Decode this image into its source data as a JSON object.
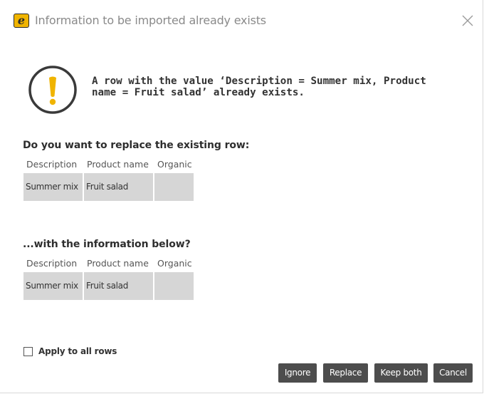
{
  "window": {
    "title": "Information to be imported already exists",
    "logo_letter": "e",
    "close_glyph": "close-icon"
  },
  "message": {
    "line1": "A row with the value ‘Description = Summer mix, Product",
    "line2": "name = Fruit salad’ already exists."
  },
  "existing": {
    "heading": "Do you want to replace the existing row:",
    "columns": [
      "Description",
      "Product name",
      "Organic"
    ],
    "row": [
      "Summer mix",
      "Fruit salad",
      ""
    ]
  },
  "incoming": {
    "heading": "...with the information below?",
    "columns": [
      "Description",
      "Product name",
      "Organic"
    ],
    "row": [
      "Summer mix",
      "Fruit salad",
      ""
    ]
  },
  "options": {
    "apply_all_label": "Apply to all rows",
    "apply_all_checked": false
  },
  "buttons": {
    "ignore": "Ignore",
    "replace": "Replace",
    "keep_both": "Keep both",
    "cancel": "Cancel"
  },
  "colors": {
    "warning_icon": "#f0b400",
    "icon_ring": "#3a3a3a",
    "button_bg": "#4d4d4d",
    "cell_bg": "#d6d6d6"
  }
}
